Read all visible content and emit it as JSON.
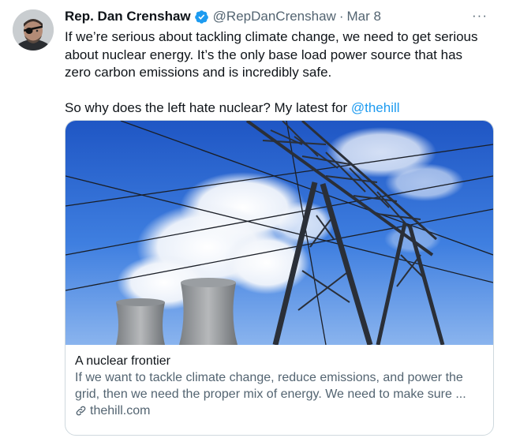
{
  "tweet": {
    "author_name": "Rep. Dan Crenshaw",
    "handle": "@RepDanCrenshaw",
    "separator": "·",
    "date": "Mar 8",
    "more_label": "···",
    "paragraph1": "If we’re serious about tackling climate change, we need to get serious about nuclear energy. It’s the only base load power source that has zero carbon emissions and is incredibly safe.",
    "paragraph2_text": "So why does the left hate nuclear? My latest for ",
    "paragraph2_mention": "@thehill"
  },
  "card": {
    "title": "A nuclear frontier",
    "description": "If we want to tackle climate change, reduce emissions, and power the grid, then we need the proper mix of energy. We need to make sure ...",
    "domain": "thehill.com"
  },
  "colors": {
    "accent": "#1d9bf0",
    "secondary_text": "#536471",
    "primary_text": "#0f1419",
    "border": "#cfd9de"
  },
  "icons": {
    "verified": "verified-badge-icon",
    "link": "link-icon",
    "more": "more-options-icon"
  }
}
